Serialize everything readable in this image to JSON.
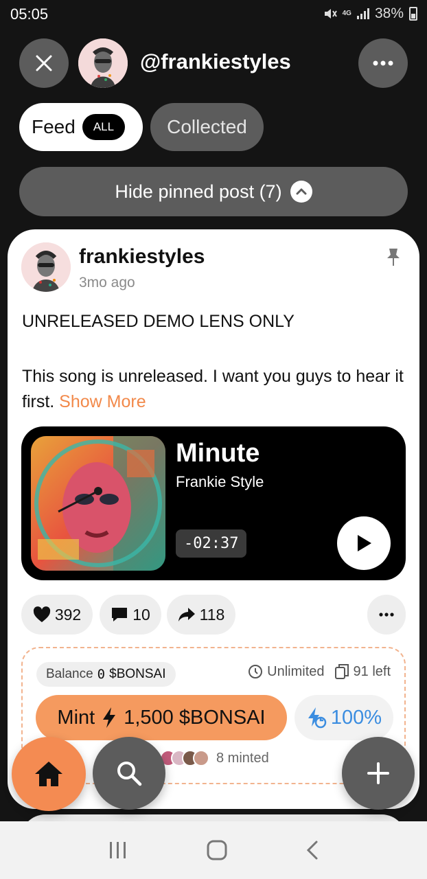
{
  "status_bar": {
    "time": "05:05",
    "network": "4G",
    "battery": "38%"
  },
  "header": {
    "handle": "@frankiestyles"
  },
  "tabs": {
    "feed_label": "Feed",
    "feed_badge": "ALL",
    "collected_label": "Collected"
  },
  "pinned_toggle": {
    "label": "Hide pinned post (7)"
  },
  "post": {
    "author": "frankiestyles",
    "time_ago": "3mo ago",
    "title": "UNRELEASED DEMO LENS ONLY",
    "body": "This song is unreleased. I want you guys to hear it first.",
    "show_more": "Show More",
    "player": {
      "song": "Minute",
      "artist": "Frankie Style",
      "remaining": "-02:37"
    },
    "stats": {
      "likes": "392",
      "comments": "10",
      "shares": "118"
    },
    "mint": {
      "balance_label": "Balance",
      "balance_value": "0",
      "balance_token": "$BONSAI",
      "duration": "Unlimited",
      "supply_left": "91 left",
      "mint_label": "Mint",
      "price": "1,500 $BONSAI",
      "reward_pct": "100%",
      "minted": "8 minted"
    }
  },
  "colors": {
    "accent": "#f48b52",
    "background": "#141414",
    "pill_gray": "#5c5c5c",
    "link_blue": "#3b8de0"
  },
  "icons": [
    "close-icon",
    "more-icon",
    "chevron-up-icon",
    "pin-icon",
    "play-icon",
    "heart-icon",
    "comment-icon",
    "share-icon",
    "timer-icon",
    "copies-icon",
    "bolt-icon",
    "home-icon",
    "search-icon",
    "plus-icon"
  ]
}
